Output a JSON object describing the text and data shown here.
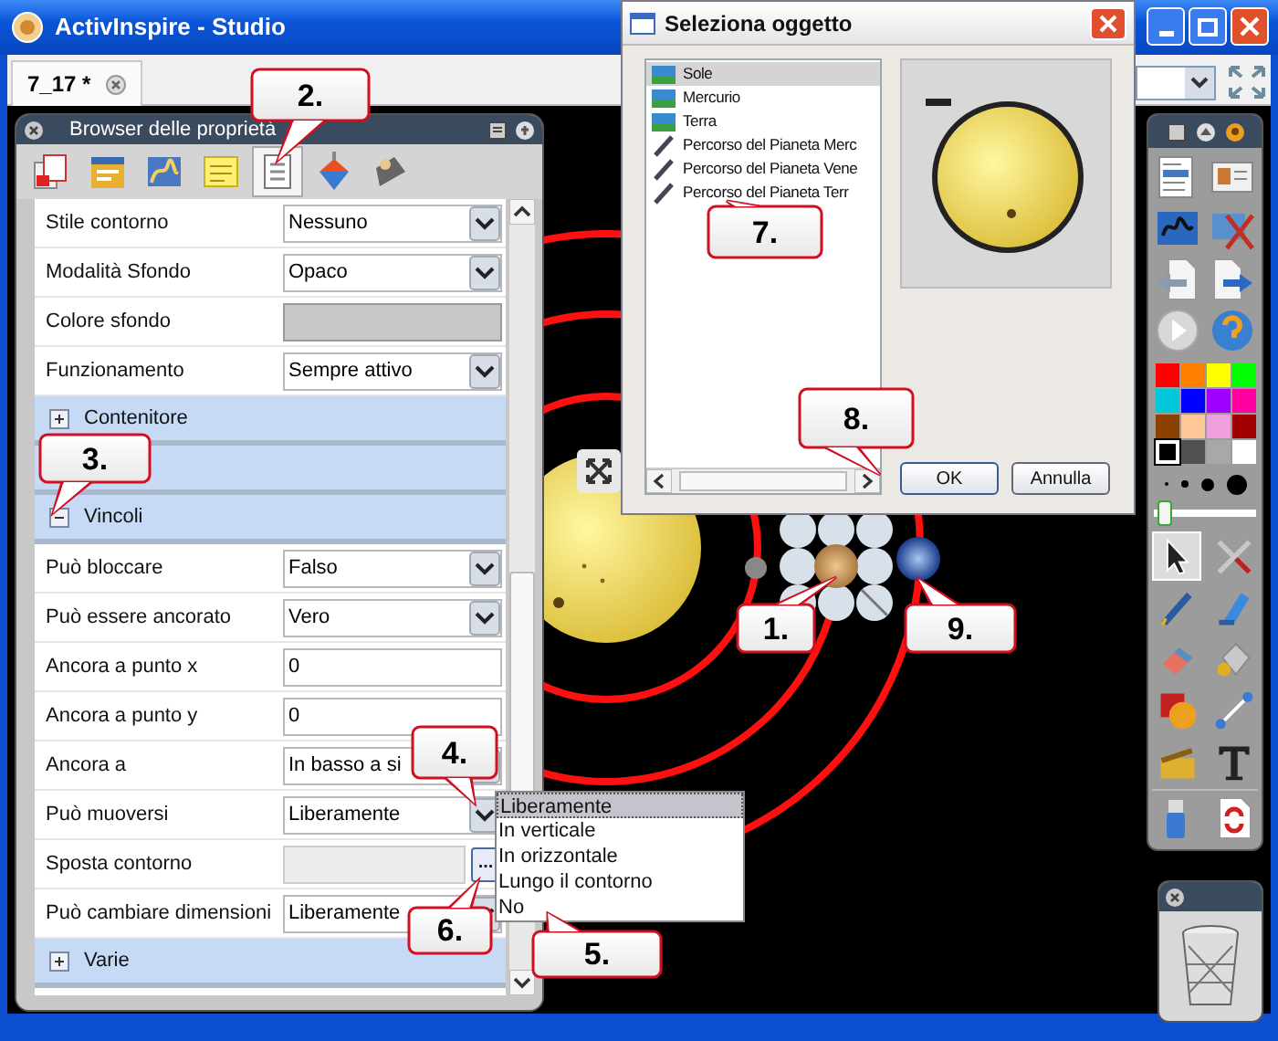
{
  "window": {
    "title": "ActivInspire - Studio"
  },
  "tabs": [
    {
      "label": "7_17 *",
      "selected": true
    }
  ],
  "property_browser": {
    "title": "Browser delle proprietà",
    "toolbar": [
      {
        "selected": false
      },
      {
        "selected": false
      },
      {
        "selected": false
      },
      {
        "selected": false
      },
      {
        "selected": true
      },
      {
        "selected": false
      },
      {
        "selected": false
      }
    ],
    "rows": [
      {
        "kind": "select",
        "label": "Stile contorno",
        "value": "Nessuno"
      },
      {
        "kind": "select",
        "label": "Modalità Sfondo",
        "value": "Opaco"
      },
      {
        "kind": "color",
        "label": "Colore sfondo"
      },
      {
        "kind": "select",
        "label": "Funzionamento",
        "value": "Sempre attivo"
      },
      {
        "kind": "group",
        "label": "Contenitore",
        "expanded": false
      },
      {
        "kind": "band"
      },
      {
        "kind": "group",
        "label": "Vincoli",
        "expanded": true
      },
      {
        "kind": "select",
        "label": "Può bloccare",
        "value": "Falso"
      },
      {
        "kind": "select",
        "label": "Può essere ancorato",
        "value": "Vero"
      },
      {
        "kind": "text",
        "label": "Ancora a punto x",
        "value": "0"
      },
      {
        "kind": "text",
        "label": "Ancora a punto y",
        "value": "0"
      },
      {
        "kind": "select",
        "label": "Ancora a",
        "value": "In basso a si"
      },
      {
        "kind": "select",
        "label": "Può muoversi",
        "value": "Liberamente"
      },
      {
        "kind": "browse",
        "label": "Sposta contorno",
        "button": "..."
      },
      {
        "kind": "select",
        "label": "Può cambiare dimensioni",
        "value": "Liberamente"
      },
      {
        "kind": "group",
        "label": "Varie",
        "expanded": false
      }
    ]
  },
  "dropdown": {
    "options": [
      {
        "label": "Liberamente",
        "selected": true
      },
      {
        "label": "In verticale",
        "selected": false
      },
      {
        "label": "In orizzontale",
        "selected": false
      },
      {
        "label": "Lungo il contorno",
        "selected": false
      },
      {
        "label": "No",
        "selected": false
      }
    ]
  },
  "dialog": {
    "title": "Seleziona oggetto",
    "items": [
      {
        "kind": "image",
        "label": "Sole",
        "selected": true
      },
      {
        "kind": "image",
        "label": "Mercurio",
        "selected": false
      },
      {
        "kind": "image",
        "label": "Terra",
        "selected": false
      },
      {
        "kind": "path",
        "label": "Percorso del Pianeta Merc",
        "selected": false
      },
      {
        "kind": "path",
        "label": "Percorso del Pianeta Vene",
        "selected": false
      },
      {
        "kind": "path",
        "label": "Percorso del Pianeta Terr",
        "selected": false
      }
    ],
    "buttons": [
      "OK",
      "Annulla"
    ]
  },
  "toolbox": {
    "colors": [
      {
        "color": "#ff0000",
        "selected": false
      },
      {
        "color": "#ff8000",
        "selected": false
      },
      {
        "color": "#ffff00",
        "selected": false
      },
      {
        "color": "#00ff00",
        "selected": false
      },
      {
        "color": "#00c8d8",
        "selected": false
      },
      {
        "color": "#0000ff",
        "selected": false
      },
      {
        "color": "#a000ff",
        "selected": false
      },
      {
        "color": "#ff00a0",
        "selected": false
      },
      {
        "color": "#8b4000",
        "selected": false
      },
      {
        "color": "#ffc896",
        "selected": false
      },
      {
        "color": "#f0a0dc",
        "selected": false
      },
      {
        "color": "#a00000",
        "selected": false
      },
      {
        "color": "#000000",
        "selected": true
      },
      {
        "color": "#505050",
        "selected": false
      },
      {
        "color": "#a8a8a8",
        "selected": false
      },
      {
        "color": "#ffffff",
        "selected": false
      }
    ],
    "thickness": {
      "level": 0.05
    },
    "tools": [
      {
        "selected": true
      },
      {
        "selected": false
      },
      {
        "selected": false
      },
      {
        "selected": false
      },
      {
        "selected": false
      },
      {
        "selected": false
      },
      {
        "selected": false
      },
      {
        "selected": false
      },
      {
        "selected": false
      },
      {
        "selected": false
      }
    ]
  },
  "callouts": [
    {
      "label": "1."
    },
    {
      "label": "2."
    },
    {
      "label": "3."
    },
    {
      "label": "4."
    },
    {
      "label": "5."
    },
    {
      "label": "6."
    },
    {
      "label": "7."
    },
    {
      "label": "8."
    },
    {
      "label": "9."
    }
  ]
}
